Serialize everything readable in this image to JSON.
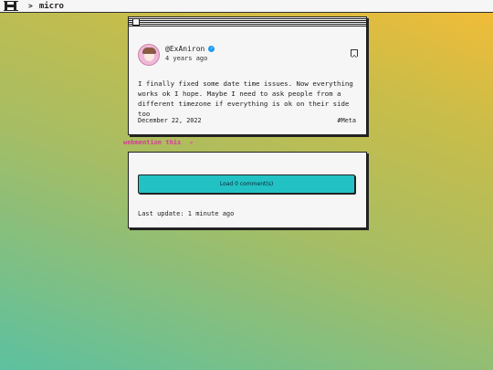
{
  "topbar": {
    "logo_icon": "h-logo-icon",
    "separator": ">",
    "breadcrumb": "micro"
  },
  "post": {
    "avatar_icon": "user-avatar",
    "username": "@ExAniron",
    "verified_icon": "verified-badge-icon",
    "time_ago": "4 years ago",
    "bookmark_icon": "bookmark-icon",
    "text": "I finally fixed some date time issues. Now everything works ok I hope. Maybe I need to ask people from a different timezone if everything is ok on their side too",
    "date": "December 22, 2022",
    "tag": "#Meta"
  },
  "webmention": {
    "label": "webmention this",
    "icon": "external-link-icon"
  },
  "comments": {
    "load_label": "Load 0 comment(s)",
    "last_update": "Last update: 1 minute ago"
  },
  "colors": {
    "accent": "#22c2c4",
    "link": "#d63a9c",
    "verified": "#1d9bf0"
  }
}
